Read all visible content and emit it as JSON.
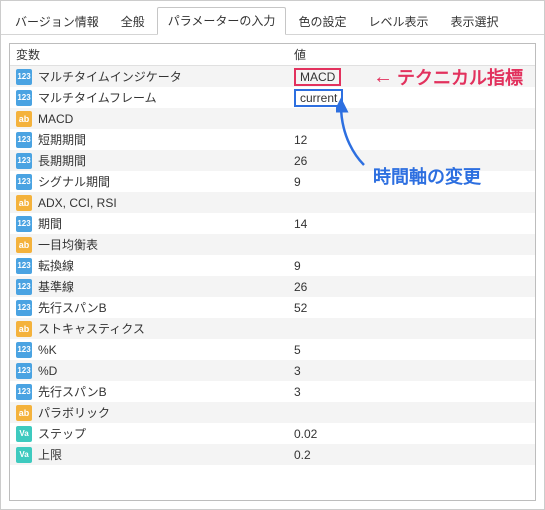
{
  "tabs": {
    "t0": "バージョン情報",
    "t1": "全般",
    "t2": "パラメーターの入力",
    "t3": "色の設定",
    "t4": "レベル表示",
    "t5": "表示選択"
  },
  "header": {
    "variable": "変数",
    "value": "値"
  },
  "rows": [
    {
      "icon": "blue123",
      "var": "マルチタイムインジケータ",
      "val": "MACD",
      "box": "red"
    },
    {
      "icon": "blue123",
      "var": "マルチタイムフレーム",
      "val": "current",
      "box": "blue"
    },
    {
      "icon": "yellowab",
      "var": "MACD",
      "val": ""
    },
    {
      "icon": "blue123",
      "var": "短期期間",
      "val": "12"
    },
    {
      "icon": "blue123",
      "var": "長期期間",
      "val": "26"
    },
    {
      "icon": "blue123",
      "var": "シグナル期間",
      "val": "9"
    },
    {
      "icon": "yellowab",
      "var": "ADX, CCI, RSI",
      "val": ""
    },
    {
      "icon": "blue123",
      "var": "期間",
      "val": "14"
    },
    {
      "icon": "yellowab",
      "var": "一目均衡表",
      "val": ""
    },
    {
      "icon": "blue123",
      "var": "転換線",
      "val": "9"
    },
    {
      "icon": "blue123",
      "var": "基準線",
      "val": "26"
    },
    {
      "icon": "blue123",
      "var": "先行スパンB",
      "val": "52"
    },
    {
      "icon": "yellowab",
      "var": "ストキャスティクス",
      "val": ""
    },
    {
      "icon": "blue123",
      "var": "%K",
      "val": "5"
    },
    {
      "icon": "blue123",
      "var": "%D",
      "val": "3"
    },
    {
      "icon": "blue123",
      "var": "先行スパンB",
      "val": "3"
    },
    {
      "icon": "yellowab",
      "var": "パラボリック",
      "val": ""
    },
    {
      "icon": "teal",
      "var": "ステップ",
      "val": "0.02"
    },
    {
      "icon": "teal",
      "var": "上限",
      "val": "0.2"
    }
  ],
  "icon_labels": {
    "blue123": "123",
    "yellowab": "ab",
    "teal": "Va"
  },
  "annotations": {
    "red_arrow": "←",
    "red_text": "テクニカル指標",
    "blue_text": "時間軸の変更"
  }
}
